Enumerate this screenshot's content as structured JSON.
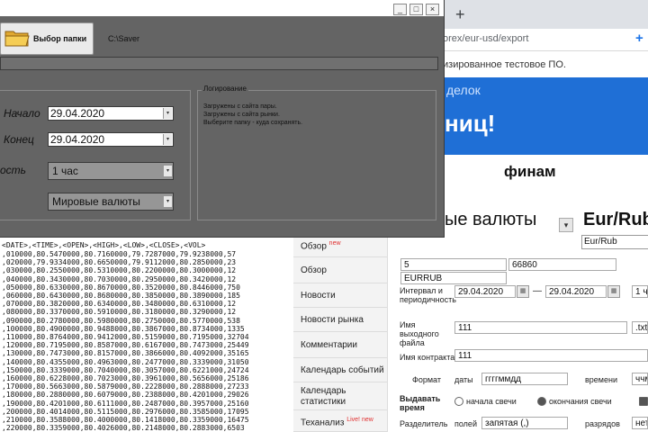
{
  "saver": {
    "folder_button_label": "Выбор папки",
    "path": "C:\\Saver",
    "start_label": "Начало",
    "start_date": "29.04.2020",
    "end_label": "Конец",
    "end_date": "29.04.2020",
    "period_label": "ость",
    "period_value": "1 час",
    "market_value": "Мировые валюты",
    "log_title": "Логирование",
    "log_lines": [
      "Загружены с сайта пары.",
      "Загружены с сайта рынки.",
      "Выберите папку - куда сохранять."
    ]
  },
  "browser": {
    "new_tab": "+",
    "url": "orex/eur-usd/export",
    "notice": "изированное тестовое ПО.",
    "banner_small": "делок",
    "banner_big": "ниц!",
    "brand": "финам",
    "market_title": "ые валюты",
    "pair_title": "Eur/Rub",
    "pair_select": "Eur/Rub",
    "menu": [
      {
        "label": "Обзор",
        "badge": "new"
      },
      {
        "label": "Обзор",
        "badge": ""
      },
      {
        "label": "Новости",
        "badge": ""
      },
      {
        "label": "Новости рынка",
        "badge": ""
      },
      {
        "label": "Комментарии",
        "badge": ""
      },
      {
        "label": "Календарь событий",
        "badge": ""
      },
      {
        "label": "Календарь статистики",
        "badge": ""
      },
      {
        "label": "Теханализ",
        "badge": "Live! new"
      }
    ],
    "form": {
      "field_market": "5",
      "field_code": "66860",
      "field_ticker": "EURRUB",
      "interval_label": "Интервал и периодичность",
      "date_from": "29.04.2020",
      "date_to": "29.04.2020",
      "period": "1 ч",
      "filename_label": "Имя выходного файла",
      "filename": "111",
      "ext": ".txt",
      "contract_label": "Имя контракта",
      "contract": "111",
      "format_label": "Формат",
      "dates_label": "даты",
      "date_format": "ггггммдд",
      "time_label": "времени",
      "time_format": "ччмм",
      "candle_time_label": "Выдавать время",
      "candle_start": "начала свечи",
      "candle_end": "окончания свечи",
      "separator_label": "Разделитель",
      "fields_label": "полей",
      "separator_value": "запятая (,)",
      "digits_label": "разрядов",
      "digits_value": "нет"
    }
  },
  "csv": {
    "header": "<DATE>,<TIME>,<OPEN>,<HIGH>,<LOW>,<CLOSE>,<VOL>",
    "lines": [
      ",010000,80.5470000,80.7160000,79.7287000,79.9238000,57",
      ",020000,79.9334000,80.6650000,79.9112000,80.2850000,23",
      ",030000,80.2550000,80.5310000,80.2200000,80.3000000,12",
      ",040000,80.3430000,80.7030000,80.2950000,80.3420000,12",
      ",050000,80.6330000,80.8670000,80.3520000,80.8446000,750",
      ",060000,80.6430000,80.8680000,80.3850000,80.3890000,185",
      ",070000,80.3820000,80.6340000,80.3480000,80.6310000,12",
      ",080000,80.3370000,80.5910000,80.3180000,80.3290000,12",
      ",090000,80.2780000,80.5980000,80.2750000,80.5770000,538",
      ",100000,80.4900000,80.9488000,80.3867000,80.8734000,1335",
      ",110000,80.8764000,80.9412000,80.5159000,80.7195000,32704",
      ",120000,80.7195000,80.8587000,80.6167000,80.7473000,25449",
      ",130000,80.7473000,80.8157000,80.3866000,80.4092000,35165",
      ",140000,80.4355000,80.4963000,80.2477000,80.3339000,31050",
      ",150000,80.3339000,80.7040000,80.3057000,80.6221000,24724",
      ",160000,80.6228000,80.7023000,80.3961000,80.5656000,25186",
      ",170000,80.5663000,80.5879000,80.2228000,80.2888000,27233",
      ",180000,80.2880000,80.6079000,80.2388000,80.4201000,29026",
      ",190000,80.4201000,80.6111000,80.2487000,80.3957000,25160",
      ",200000,80.4014000,80.5115000,80.2976000,80.3585000,17095",
      ",210000,80.3588000,80.4000000,80.1418000,80.3359000,16475",
      ",220000,80.3359000,80.4026000,80.2148000,80.2883000,6503"
    ]
  }
}
